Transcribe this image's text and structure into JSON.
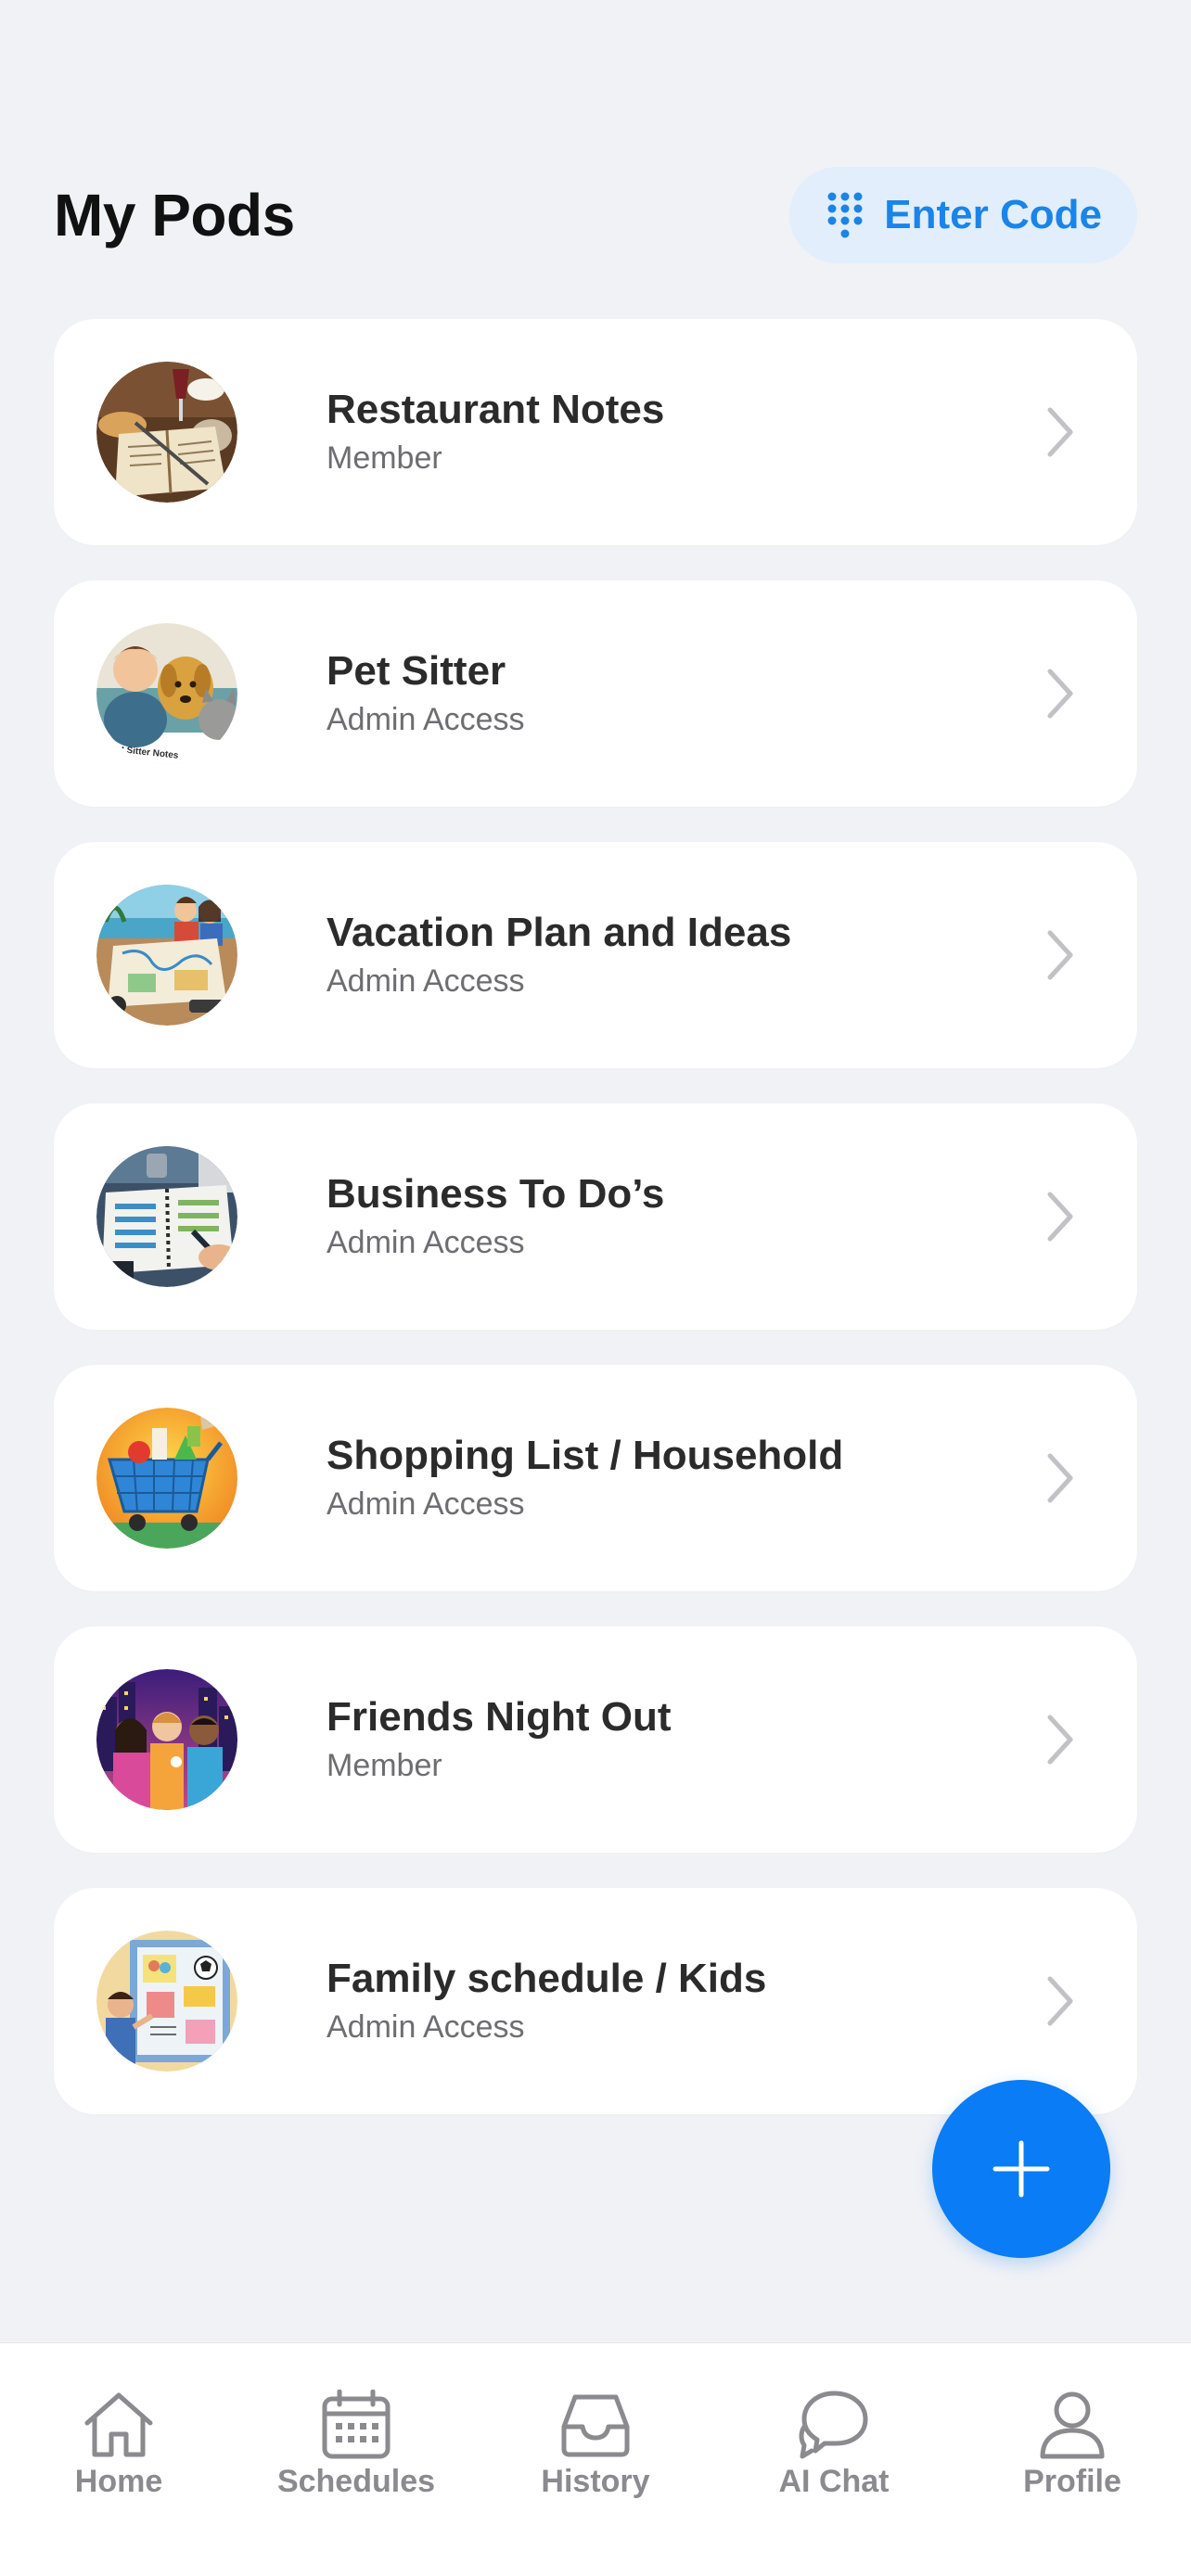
{
  "header": {
    "title": "My Pods",
    "enter_code_label": "Enter Code",
    "enter_code_icon": "keypad-icon"
  },
  "colors": {
    "accent": "#0a7cf5",
    "enter_code_bg": "#e2eefb",
    "background": "#f1f2f6"
  },
  "pods": [
    {
      "title": "Restaurant Notes",
      "role": "Member",
      "icon": "restaurant-notebook-image"
    },
    {
      "title": "Pet Sitter",
      "role": "Admin Access",
      "icon": "pet-sitter-image",
      "image_text": "Pet Sitter Notes"
    },
    {
      "title": "Vacation Plan and Ideas",
      "role": "Admin Access",
      "icon": "vacation-map-image"
    },
    {
      "title": "Business To Do’s",
      "role": "Admin Access",
      "icon": "business-planner-image"
    },
    {
      "title": "Shopping List / Household",
      "role": "Admin Access",
      "icon": "shopping-cart-image"
    },
    {
      "title": "Friends Night Out",
      "role": "Member",
      "icon": "friends-city-image"
    },
    {
      "title": "Family schedule / Kids",
      "role": "Admin Access",
      "icon": "family-board-image"
    }
  ],
  "fab": {
    "icon": "plus-icon"
  },
  "tabbar": {
    "tabs": [
      {
        "label": "Home",
        "icon": "home-icon"
      },
      {
        "label": "Schedules",
        "icon": "calendar-icon"
      },
      {
        "label": "History",
        "icon": "inbox-tray-icon"
      },
      {
        "label": "AI Chat",
        "icon": "chat-bubbles-icon"
      },
      {
        "label": "Profile",
        "icon": "person-icon"
      }
    ]
  }
}
